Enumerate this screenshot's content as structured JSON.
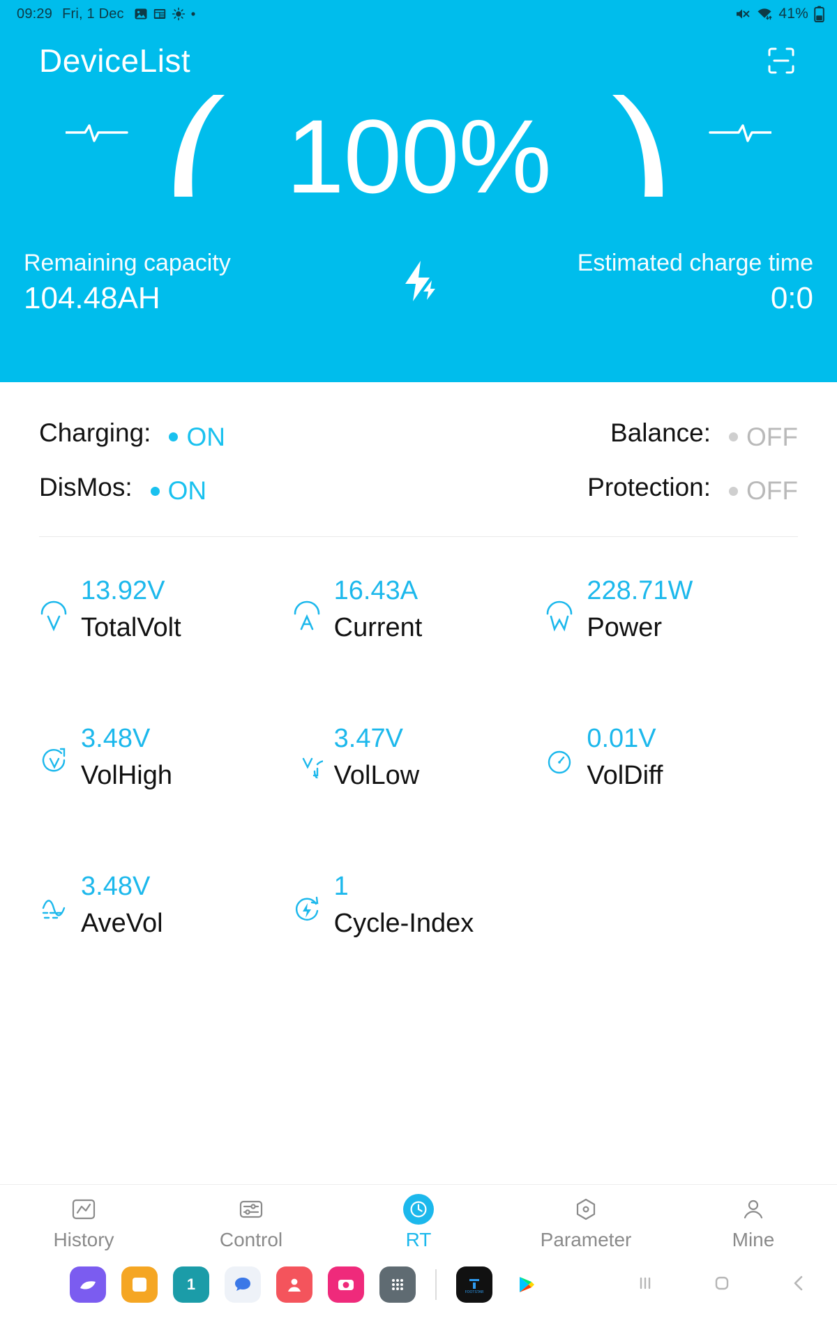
{
  "statusbar": {
    "time": "09:29",
    "date": "Fri, 1 Dec",
    "battery_pct": "41%",
    "icons": [
      "image-icon",
      "news-icon",
      "brightness-icon",
      "dot-icon"
    ],
    "right_icons": [
      "mute-icon",
      "wifi-icon",
      "battery-icon"
    ]
  },
  "header": {
    "title": "DeviceList",
    "scan_icon": "scan-icon",
    "soc_percent": "100%",
    "remaining_label": "Remaining capacity",
    "remaining_value": "104.48AH",
    "charge_time_label": "Estimated charge time",
    "charge_time_value": "0:0",
    "bolt_icon": "charging-bolt-icon"
  },
  "status": {
    "rows": [
      {
        "left": {
          "label": "Charging:",
          "value": "ON",
          "state": "on"
        },
        "right": {
          "label": "Balance:",
          "value": "OFF",
          "state": "off"
        }
      },
      {
        "left": {
          "label": "DisMos:",
          "value": "ON",
          "state": "on"
        },
        "right": {
          "label": "Protection:",
          "value": "OFF",
          "state": "off"
        }
      }
    ]
  },
  "metrics": [
    {
      "value": "13.92V",
      "label": "TotalVolt",
      "icon": "volt-arc-icon"
    },
    {
      "value": "16.43A",
      "label": "Current",
      "icon": "ampere-arc-icon"
    },
    {
      "value": "228.71W",
      "label": "Power",
      "icon": "watt-arc-icon"
    },
    {
      "value": "3.48V",
      "label": "VolHigh",
      "icon": "volt-high-icon"
    },
    {
      "value": "3.47V",
      "label": "VolLow",
      "icon": "volt-low-icon"
    },
    {
      "value": "0.01V",
      "label": "VolDiff",
      "icon": "gauge-icon"
    },
    {
      "value": "3.48V",
      "label": "AveVol",
      "icon": "average-wave-icon"
    },
    {
      "value": "1",
      "label": "Cycle-Index",
      "icon": "cycle-icon"
    }
  ],
  "tabs": [
    {
      "label": "History",
      "icon": "chart-icon",
      "active": false
    },
    {
      "label": "Control",
      "icon": "sliders-icon",
      "active": false
    },
    {
      "label": "RT",
      "icon": "realtime-icon",
      "active": true
    },
    {
      "label": "Parameter",
      "icon": "hexagon-icon",
      "active": false
    },
    {
      "label": "Mine",
      "icon": "person-icon",
      "active": false
    }
  ],
  "dock": {
    "apps": [
      {
        "name": "gallery-app-icon",
        "color": "#7b5cf0",
        "glyph": "◠"
      },
      {
        "name": "notes-app-icon",
        "color": "#f5a623",
        "glyph": "▢"
      },
      {
        "name": "calendar-app-icon",
        "color": "#1b9ca8",
        "glyph": "1"
      },
      {
        "name": "messages-app-icon",
        "color": "#f2f4f8",
        "glyph": "💬"
      },
      {
        "name": "contacts-app-icon",
        "color": "#f4545c",
        "glyph": "◉"
      },
      {
        "name": "camera-app-icon",
        "color": "#ef2a7b",
        "glyph": "◎"
      },
      {
        "name": "apps-grid-icon",
        "color": "#5f6b72",
        "glyph": "⠿"
      },
      {
        "name": "footstar-app-icon",
        "color": "#111111",
        "glyph": "F"
      },
      {
        "name": "play-store-icon",
        "color": "#ffffff",
        "glyph": "▶"
      }
    ],
    "nav": [
      "recents-button",
      "home-button",
      "back-button"
    ]
  },
  "colors": {
    "brand": "#00bdec",
    "accent": "#1cb8ec",
    "off": "#b9b9b9"
  }
}
